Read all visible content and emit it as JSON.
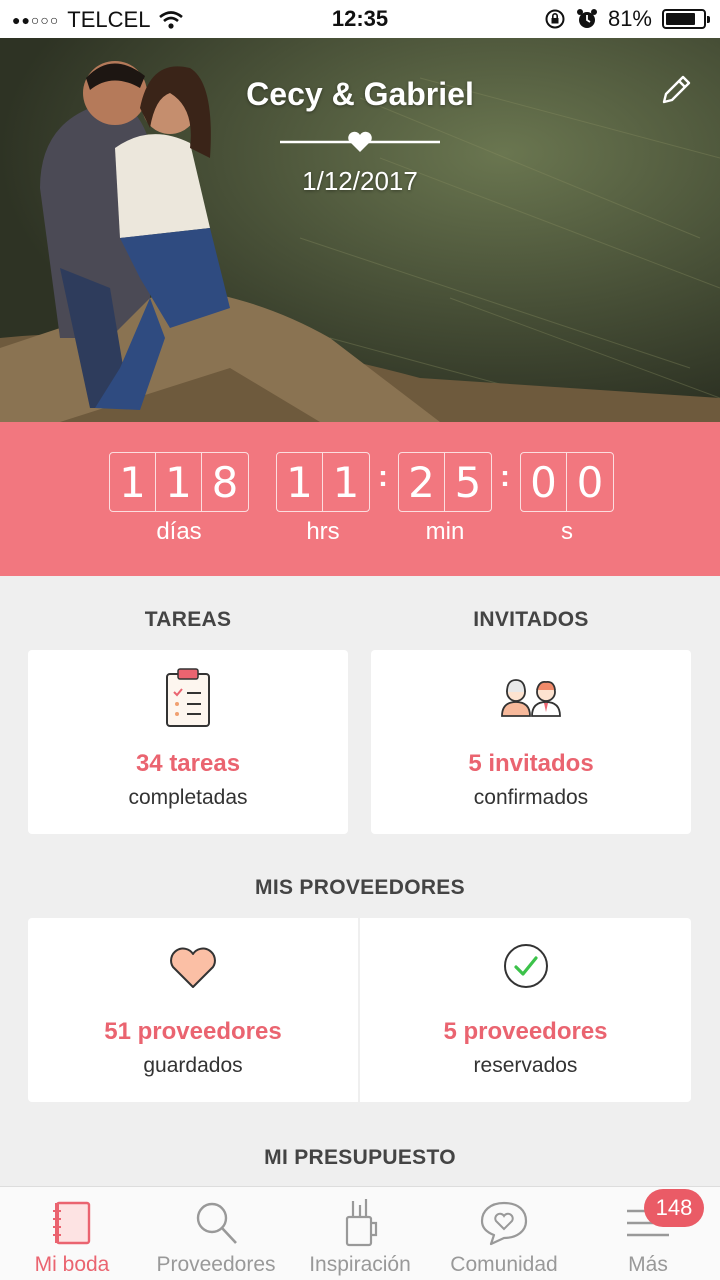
{
  "status_bar": {
    "carrier": "TELCEL",
    "time": "12:35",
    "battery_percent": "81%",
    "battery_level": 0.81
  },
  "hero": {
    "couple_names": "Cecy & Gabriel",
    "wedding_date": "1/12/2017"
  },
  "countdown": {
    "days": [
      "1",
      "1",
      "8"
    ],
    "hours": [
      "1",
      "1"
    ],
    "minutes": [
      "2",
      "5"
    ],
    "seconds": [
      "0",
      "0"
    ],
    "labels": {
      "days": "días",
      "hours": "hrs",
      "minutes": "min",
      "seconds": "s"
    }
  },
  "tareas": {
    "title": "TAREAS",
    "count_text": "34 tareas",
    "sub_text": "completadas"
  },
  "invitados": {
    "title": "INVITADOS",
    "count_text": "5 invitados",
    "sub_text": "confirmados"
  },
  "proveedores": {
    "title": "MIS PROVEEDORES",
    "saved_text": "51 proveedores",
    "saved_sub": "guardados",
    "booked_text": "5 proveedores",
    "booked_sub": "reservados"
  },
  "presupuesto": {
    "title": "MI PRESUPUESTO"
  },
  "tabs": [
    {
      "label": "Mi boda",
      "icon": "notebook-icon",
      "active": true
    },
    {
      "label": "Proveedores",
      "icon": "search-icon",
      "active": false
    },
    {
      "label": "Inspiración",
      "icon": "inspiration-icon",
      "active": false
    },
    {
      "label": "Comunidad",
      "icon": "chat-heart-icon",
      "active": false
    },
    {
      "label": "Más",
      "icon": "menu-icon",
      "active": false,
      "badge": "148"
    }
  ],
  "colors": {
    "accent": "#ea6470",
    "countdown_bg": "#f2777f",
    "background": "#efefef"
  }
}
